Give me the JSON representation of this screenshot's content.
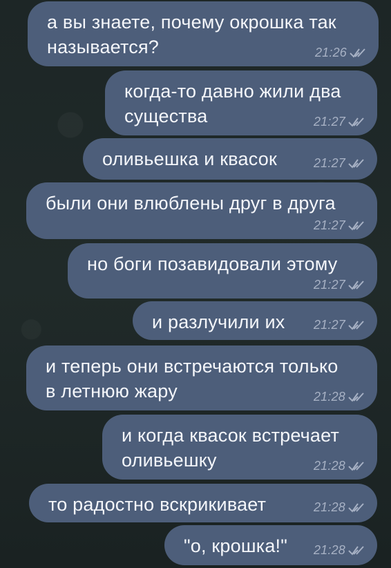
{
  "messages": [
    {
      "text": "а вы знаете, почему окрошка так\nназывается?",
      "time": "21:26"
    },
    {
      "text": "когда-то давно жили два\nсущества",
      "time": "21:27"
    },
    {
      "text": "оливьешка и квасок",
      "time": "21:27"
    },
    {
      "text": "были они влюблены друг в друга",
      "time": "21:27"
    },
    {
      "text": "но боги позавидовали этому",
      "time": "21:27"
    },
    {
      "text": "и разлучили их",
      "time": "21:27"
    },
    {
      "text": "и теперь они встречаются только\nв летнюю жару",
      "time": "21:28"
    },
    {
      "text": "и когда квасок встречает\nоливьешку",
      "time": "21:28"
    },
    {
      "text": "то радостно вскрикивает",
      "time": "21:28"
    },
    {
      "text": "\"о, крошка!\"",
      "time": "21:28"
    }
  ],
  "colors": {
    "bubble": "#4d5e7a",
    "text": "#f4f6fa",
    "meta": "#a7b1c4",
    "background": "#1c2424"
  },
  "icons": {
    "read_status": "double-check-icon"
  }
}
